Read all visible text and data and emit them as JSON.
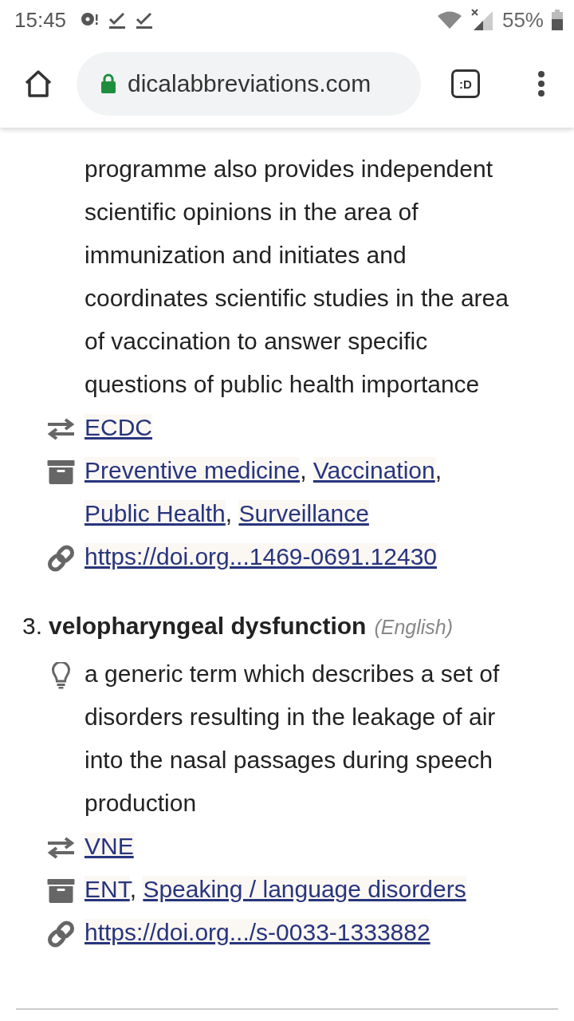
{
  "status_bar": {
    "time": "15:45",
    "battery": "55%"
  },
  "toolbar": {
    "url": "dicalabbreviations.com",
    "tab_switcher": ":D"
  },
  "entries": [
    {
      "continued": true,
      "definition": "programme also provides independent scientific opinions in the area of immunization and initiates and coordinates scientific studies in the area of vaccination to answer specific questions of public health importance",
      "abbreviation": "ECDC",
      "separator": ",",
      "categories": [
        "Preventive medicine",
        "Vaccination",
        "Public Health",
        "Surveillance"
      ],
      "link": "https://doi.org...1469-0691.12430"
    },
    {
      "continued": false,
      "number": "3.",
      "term": "velopharyngeal dysfunction",
      "language": "(English)",
      "definition": "a generic term which describes a set of disorders resulting in the leakage of air into the nasal passages during speech production",
      "abbreviation": "VNE",
      "separator": ",",
      "categories": [
        "ENT",
        "Speaking / language disorders"
      ],
      "link": "https://doi.org.../s-0033-1333882"
    }
  ]
}
